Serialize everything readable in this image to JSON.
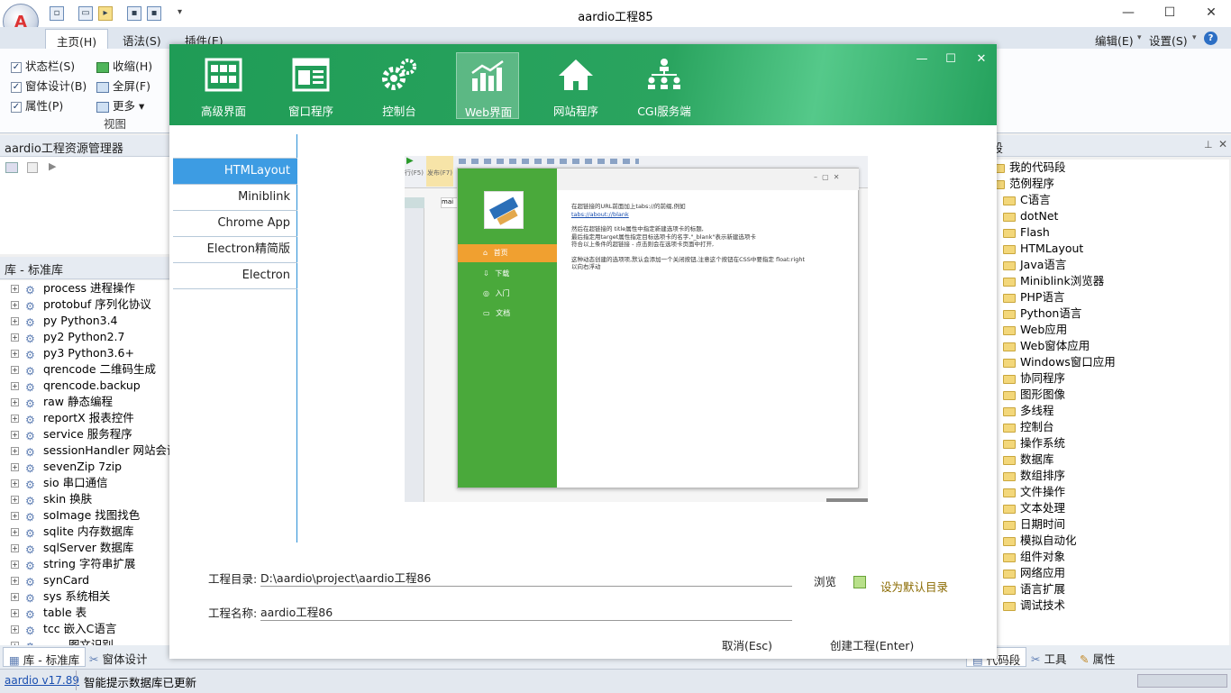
{
  "app": {
    "title": "aardio工程85",
    "logo": "A",
    "window_controls": [
      "—",
      "☐",
      "✕"
    ]
  },
  "ribbon": {
    "tabs": [
      {
        "label": "主页(H)",
        "active": true
      },
      {
        "label": "语法(S)",
        "active": false
      },
      {
        "label": "插件(E)",
        "active": false
      }
    ],
    "right_menu": {
      "edit": "编辑(E)",
      "settings": "设置(S)",
      "help": "?"
    },
    "view_group": {
      "label": "视图",
      "checkboxes": [
        {
          "label": "状态栏(S)",
          "checked": true
        },
        {
          "label": "窗体设计(B)",
          "checked": true
        },
        {
          "label": "属性(P)",
          "checked": true
        }
      ],
      "buttons": [
        {
          "label": "收缩(H)"
        },
        {
          "label": "全屏(F)"
        },
        {
          "label": "更多 ▾"
        }
      ]
    }
  },
  "left_panel": {
    "project_header": "aardio工程资源管理器",
    "lib_header": "库 - 标准库",
    "lib_items": [
      "process 进程操作",
      "protobuf 序列化协议",
      "py Python3.4",
      "py2 Python2.7",
      "py3 Python3.6+",
      "qrencode 二维码生成",
      "qrencode.backup",
      "raw 静态编程",
      "reportX 报表控件",
      "service 服务程序",
      "sessionHandler 网站会话管",
      "sevenZip 7zip",
      "sio 串口通信",
      "skin 换肤",
      "soImage 找图找色",
      "sqlite 内存数据库",
      "sqlServer 数据库",
      "string 字符串扩展",
      "synCard",
      "sys 系统相关",
      "table 表",
      "tcc 嵌入C语言",
      "...... 图文识别"
    ]
  },
  "right_panel": {
    "header": "段",
    "tree": [
      {
        "label": "我的代码段",
        "level": 0
      },
      {
        "label": "范例程序",
        "level": 0
      },
      {
        "label": "C语言",
        "level": 1
      },
      {
        "label": "dotNet",
        "level": 1
      },
      {
        "label": "Flash",
        "level": 1
      },
      {
        "label": "HTMLayout",
        "level": 1
      },
      {
        "label": "Java语言",
        "level": 1
      },
      {
        "label": "Miniblink浏览器",
        "level": 1
      },
      {
        "label": "PHP语言",
        "level": 1
      },
      {
        "label": "Python语言",
        "level": 1
      },
      {
        "label": "Web应用",
        "level": 1
      },
      {
        "label": "Web窗体应用",
        "level": 1
      },
      {
        "label": "Windows窗口应用",
        "level": 1
      },
      {
        "label": "协同程序",
        "level": 1
      },
      {
        "label": "图形图像",
        "level": 1
      },
      {
        "label": "多线程",
        "level": 1
      },
      {
        "label": "控制台",
        "level": 1
      },
      {
        "label": "操作系统",
        "level": 1
      },
      {
        "label": "数据库",
        "level": 1
      },
      {
        "label": "数组排序",
        "level": 1
      },
      {
        "label": "文件操作",
        "level": 1
      },
      {
        "label": "文本处理",
        "level": 1
      },
      {
        "label": "日期时间",
        "level": 1
      },
      {
        "label": "模拟自动化",
        "level": 1
      },
      {
        "label": "组件对象",
        "level": 1
      },
      {
        "label": "网络应用",
        "level": 1
      },
      {
        "label": "语言扩展",
        "level": 1
      },
      {
        "label": "调试技术",
        "level": 1
      }
    ]
  },
  "bottom_tabs": {
    "left": [
      "库 - 标准库",
      "窗体设计"
    ],
    "right": [
      "代码段",
      "工具",
      "属性"
    ]
  },
  "status": {
    "version": "aardio v17.89",
    "message": "智能提示数据库已更新"
  },
  "dialog": {
    "templates": [
      {
        "label": "高级界面",
        "icon": "grid-layout-icon",
        "active": false
      },
      {
        "label": "窗口程序",
        "icon": "window-app-icon",
        "active": false
      },
      {
        "label": "控制台",
        "icon": "gears-icon",
        "active": false
      },
      {
        "label": "Web界面",
        "icon": "bar-chart-icon",
        "active": true
      },
      {
        "label": "网站程序",
        "icon": "home-icon",
        "active": false
      },
      {
        "label": "CGI服务端",
        "icon": "network-tree-icon",
        "active": false
      }
    ],
    "controls": [
      "—",
      "☐",
      "✕"
    ],
    "nav": [
      {
        "label": "HTMLayout",
        "active": true
      },
      {
        "label": "Miniblink",
        "active": false
      },
      {
        "label": "Chrome App",
        "active": false
      },
      {
        "label": "Electron精简版",
        "active": false
      },
      {
        "label": "Electron",
        "active": false
      }
    ],
    "preview": {
      "menu": [
        "首页",
        "下载",
        "入门",
        "文档"
      ],
      "text": [
        "在超链接的URL前面加上tabs://的前缀,例如",
        "tabs://about://blank",
        "然后在超链接的 title属性中指定新建选项卡的标题,",
        "最后指定用target属性指定目标选项卡的名字,\"_blank\"表示新建选项卡",
        "符合以上条件的超链接 - 点击则会在选项卡页面中打开,",
        "这种动态创建的选项项,默认会添加一个关闭按钮,注意这个按钮在CSS中要指定 float:right",
        "以向右浮动"
      ],
      "toolbar_labels": [
        "行(F5)",
        "发布(F7)"
      ],
      "tab_label": "mai"
    },
    "form": {
      "dir_label": "工程目录:",
      "dir_value": "D:\\aardio\\project\\aardio工程86",
      "browse": "浏览",
      "default_dir": "设为默认目录",
      "name_label": "工程名称:",
      "name_value": "aardio工程86",
      "cancel": "取消(Esc)",
      "create": "创建工程(Enter)"
    },
    "colors": {
      "header_green": "#22a05a",
      "nav_active": "#3d9ce3",
      "preview_green": "#4aa93b",
      "preview_orange": "#f0a030"
    }
  }
}
